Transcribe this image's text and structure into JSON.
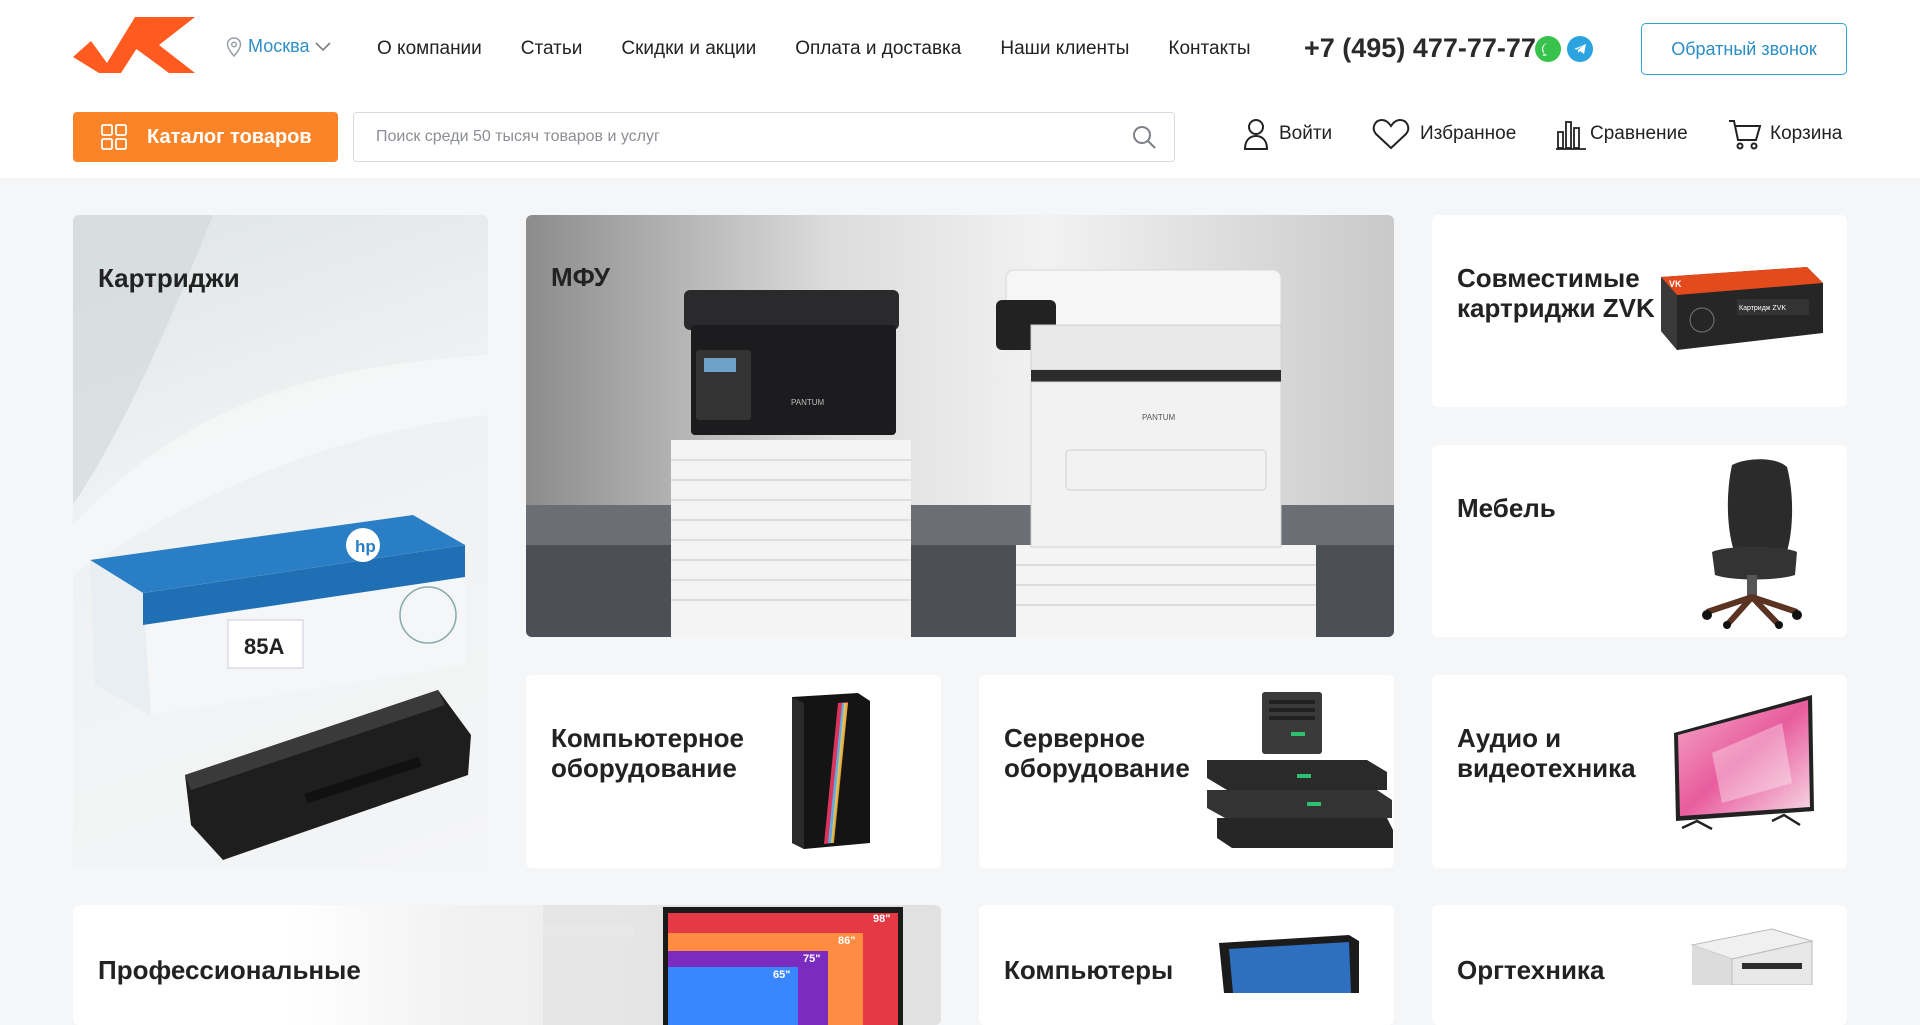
{
  "header": {
    "city": "Москва",
    "nav": [
      "О компании",
      "Статьи",
      "Скидки и акции",
      "Оплата и доставка",
      "Наши клиенты",
      "Контакты"
    ],
    "phone": "+7 (495) 477-77-77",
    "callback_label": "Обратный звонок",
    "catalog_label": "Каталог товаров",
    "search_placeholder": "Поиск среди 50 тысяч товаров и услуг",
    "login_label": "Войти",
    "favorites_label": "Избранное",
    "compare_label": "Сравнение",
    "cart_label": "Корзина"
  },
  "colors": {
    "accent": "#fb8429",
    "link": "#2a8dc6",
    "logo": "#ff5a1f",
    "whatsapp": "#37c24c",
    "telegram": "#2aa3df"
  },
  "tiles": {
    "cartridges": "Картриджи",
    "mfu": "МФУ",
    "zvk": "Совместимые картриджи ZVK",
    "furniture": "Мебель",
    "computer_equipment": "Компьютерное оборудование",
    "server_equipment": "Серверное оборудование",
    "audio_video": "Аудио и видеотехника",
    "professional": "Профессиональные",
    "computers": "Компьютеры",
    "office": "Оргтехника"
  },
  "images": {
    "hp_box_label": "85A",
    "zvk_box_label": "Картридж ZVK",
    "tv_sizes": [
      "98\"",
      "86\"",
      "75\"",
      "65\""
    ]
  }
}
